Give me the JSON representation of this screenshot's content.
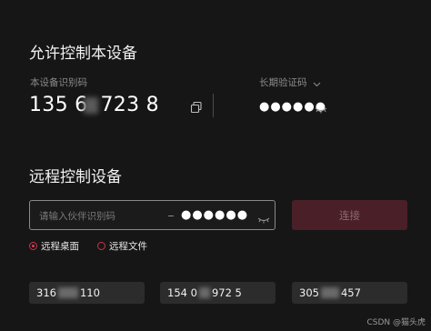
{
  "remote_allow": {
    "title": "允许控制本设备",
    "device_id_label": "本设备识别码",
    "device_id_prefix": "135 6",
    "device_id_suffix": "723 8",
    "copy_icon": "copy-icon",
    "verify_label": "长期验证码",
    "verify_dropdown_icon": "chevron-down-icon",
    "verify_code_masked": "●●●●●●",
    "eye_icon": "eye-closed-icon"
  },
  "remote_control": {
    "title": "远程控制设备",
    "partner_input_placeholder": "请输入伙伴识别码",
    "partner_code_masked": "●●●●●●",
    "eye_icon": "eye-closed-icon",
    "connect_label": "连接",
    "modes": [
      {
        "label": "远程桌面",
        "selected": true
      },
      {
        "label": "远程文件",
        "selected": false
      }
    ],
    "recent_devices": [
      {
        "prefix": "316",
        "suffix": "110"
      },
      {
        "prefix": "154 0",
        "suffix": "972 5"
      },
      {
        "prefix": "305",
        "suffix": "457"
      }
    ]
  },
  "watermark": "CSDN @猫头虎",
  "colors": {
    "background": "#161616",
    "accent": "#e03c58",
    "connect_disabled": "#4a1f28"
  }
}
